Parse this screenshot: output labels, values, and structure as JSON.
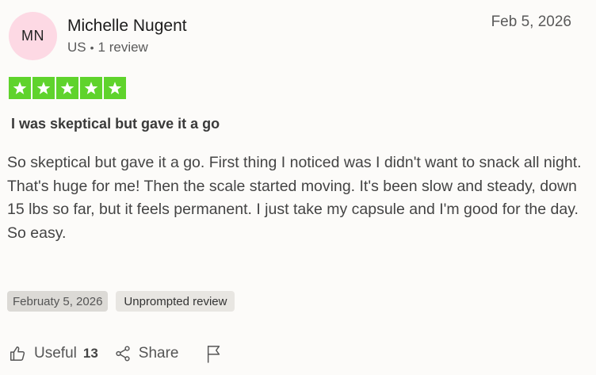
{
  "reviewer": {
    "initials": "MN",
    "name": "Michelle Nugent",
    "country": "US",
    "separator": "•",
    "review_count": "1 review"
  },
  "review": {
    "date": "Feb 5, 2026",
    "rating": 5,
    "rating_max": 5,
    "title": "I was skeptical but gave it a go",
    "body": "So skeptical but gave it a go. First thing I noticed was I didn't want to snack all night. That's huge for me! Then the scale started moving. It's been slow and steady, down 15 lbs so far, but it feels permanent. I just take my capsule and I'm good for the day. So easy.",
    "experience_date": "Februaty 5, 2026",
    "tag": "Unprompted review"
  },
  "actions": {
    "useful_label": "Useful",
    "useful_count": "13",
    "share_label": "Share"
  },
  "colors": {
    "star_bg": "#5fd32c",
    "avatar_bg": "#fdd9e4"
  },
  "icons": {
    "useful": "thumbs-up-icon",
    "share": "share-icon",
    "report": "flag-icon"
  }
}
